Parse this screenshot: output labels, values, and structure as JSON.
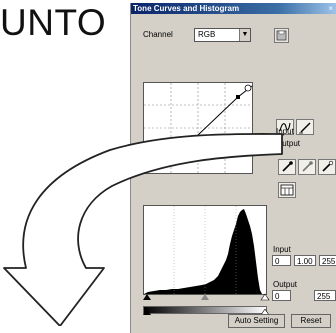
{
  "fragment_text": "UNTO",
  "window": {
    "title": "Tone Curves and Histogram",
    "close_glyph": "×",
    "channel_label": "Channel",
    "channel_value": "RGB",
    "channel_options": [
      "RGB"
    ],
    "input_label": "Input",
    "output_label": "Output",
    "histogram": {
      "input_label": "Input",
      "input_values": [
        "0",
        "1.00",
        "255"
      ],
      "output_label": "Output",
      "output_values": [
        "0",
        "255"
      ]
    },
    "buttons": {
      "auto_setting": "Auto Setting",
      "reset": "Reset"
    }
  }
}
